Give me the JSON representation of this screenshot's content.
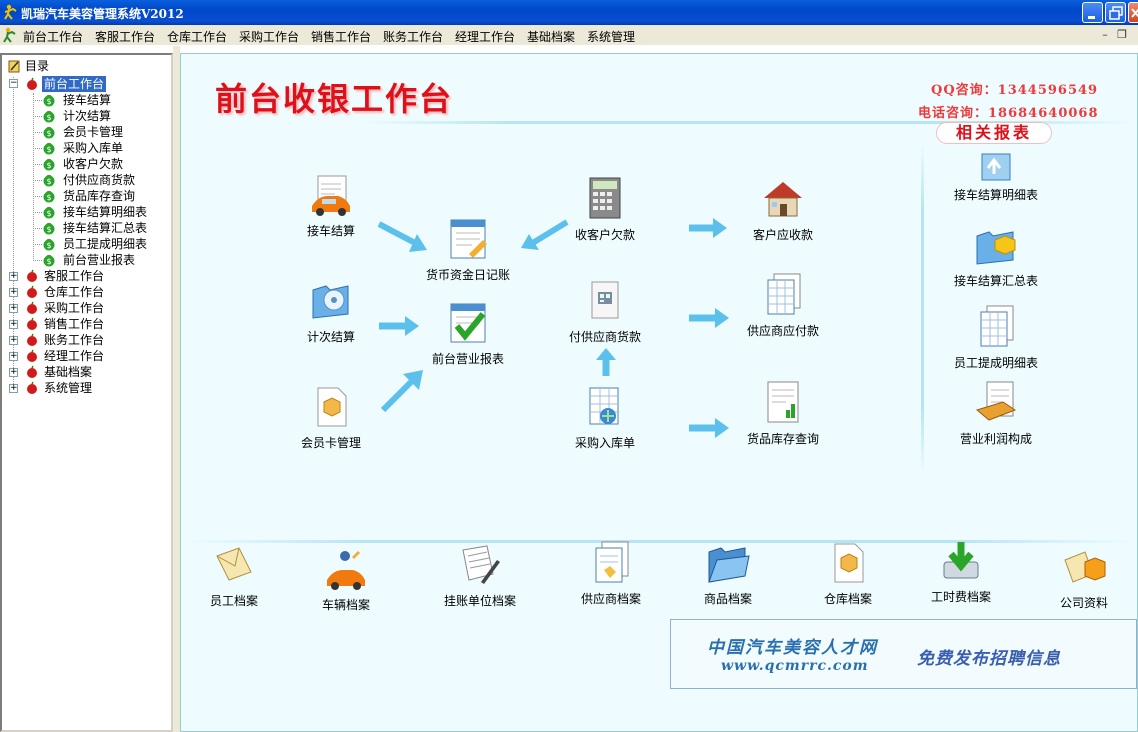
{
  "window": {
    "title": "凯瑞汽车美容管理系统V2012"
  },
  "menu": [
    "前台工作台",
    "客服工作台",
    "仓库工作台",
    "采购工作台",
    "销售工作台",
    "账务工作台",
    "经理工作台",
    "基础档案",
    "系统管理"
  ],
  "tree": {
    "root": "目录",
    "expanded": "前台工作台",
    "children": [
      "接车结算",
      "计次结算",
      "会员卡管理",
      "采购入库单",
      "收客户欠款",
      "付供应商货款",
      "货品库存查询",
      "接车结算明细表",
      "接车结算汇总表",
      "员工提成明细表",
      "前台营业报表"
    ],
    "collapsed": [
      "客服工作台",
      "仓库工作台",
      "采购工作台",
      "销售工作台",
      "账务工作台",
      "经理工作台",
      "基础档案",
      "系统管理"
    ]
  },
  "main": {
    "title": "前台收银工作台",
    "qq": "QQ咨询：1344596549",
    "phone": "电话咨询：18684640068",
    "reports_header": "相关报表",
    "flow": {
      "checkout": "接车结算",
      "count_checkout": "计次结算",
      "member_card": "会员卡管理",
      "cash_journal": "货币资金日记账",
      "front_report": "前台营业报表",
      "collect_debt": "收客户欠款",
      "pay_supplier": "付供应商货款",
      "purchase_in": "采购入库单",
      "receivable": "客户应收款",
      "payable": "供应商应付款",
      "stock_query": "货品库存查询"
    },
    "reports": [
      "接车结算明细表",
      "接车结算汇总表",
      "员工提成明细表",
      "营业利润构成"
    ],
    "archives": [
      "员工档案",
      "车辆档案",
      "挂账单位档案",
      "供应商档案",
      "商品档案",
      "仓库档案",
      "工时费档案",
      "公司资料"
    ],
    "banner": {
      "site_name": "中国汽车美容人才网",
      "url": "www.qcmrrc.com",
      "slogan": "免费发布招聘信息"
    }
  },
  "colors": {
    "title_red": "#e0101a",
    "arrow_blue": "#5cc0ec",
    "selection": "#316ac5"
  }
}
